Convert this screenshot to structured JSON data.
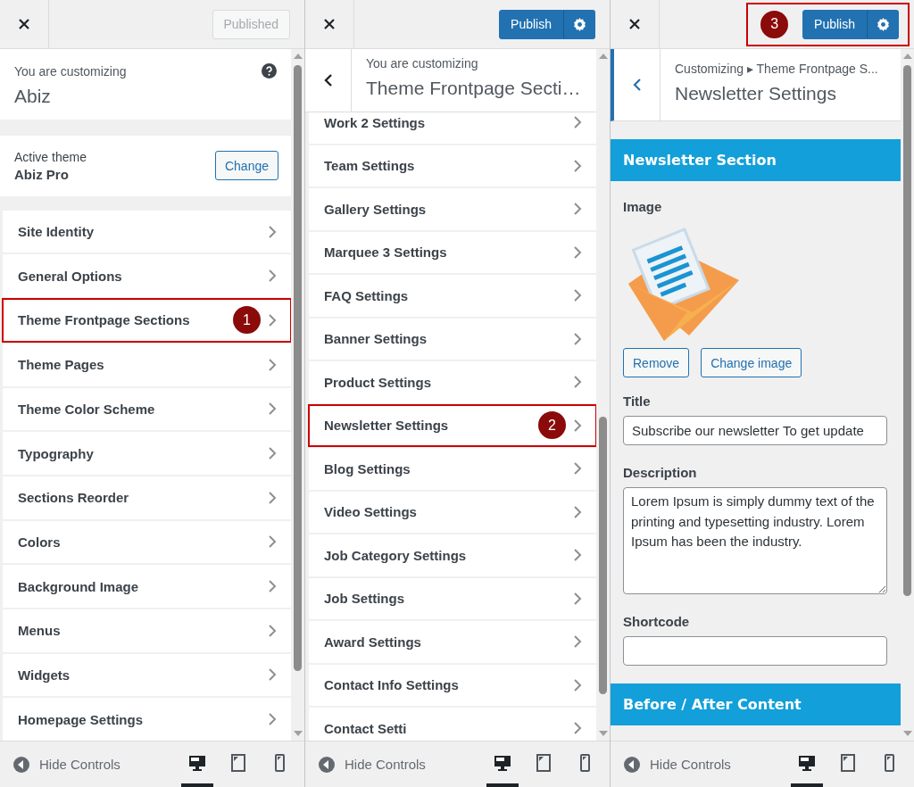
{
  "panels": [
    {
      "kind": "root",
      "publish": {
        "label": "Published",
        "disabled": true,
        "gear": false
      },
      "customizing": {
        "label": "You are customizing",
        "title": "Abiz"
      },
      "active_theme": {
        "label": "Active theme",
        "name": "Abiz Pro",
        "button": "Change"
      },
      "items": [
        {
          "label": "Site Identity",
          "highlighted": false
        },
        {
          "label": "General Options",
          "highlighted": false
        },
        {
          "label": "Theme Frontpage Sections",
          "highlighted": true,
          "callout": "1"
        },
        {
          "label": "Theme Pages",
          "highlighted": false
        },
        {
          "label": "Theme Color Scheme",
          "highlighted": false
        },
        {
          "label": "Typography",
          "highlighted": false
        },
        {
          "label": "Sections Reorder",
          "highlighted": false
        },
        {
          "label": "Colors",
          "highlighted": false
        },
        {
          "label": "Background Image",
          "highlighted": false
        },
        {
          "label": "Menus",
          "highlighted": false
        },
        {
          "label": "Widgets",
          "highlighted": false
        },
        {
          "label": "Homepage Settings",
          "highlighted": false
        }
      ],
      "footer": {
        "hide_label": "Hide Controls",
        "devices": [
          {
            "kind": "desktop",
            "selected": true
          },
          {
            "kind": "tablet",
            "selected": false
          },
          {
            "kind": "mobile",
            "selected": false
          }
        ]
      }
    },
    {
      "kind": "section",
      "publish": {
        "label": "Publish",
        "disabled": false,
        "gear": true
      },
      "customizing": {
        "label": "You are customizing",
        "title": "Theme Frontpage Secti…"
      },
      "items": [
        {
          "label": "Work 2 Settings",
          "highlighted": false
        },
        {
          "label": "Team Settings",
          "highlighted": false
        },
        {
          "label": "Gallery Settings",
          "highlighted": false
        },
        {
          "label": "Marquee 3 Settings",
          "highlighted": false
        },
        {
          "label": "FAQ Settings",
          "highlighted": false
        },
        {
          "label": "Banner Settings",
          "highlighted": false
        },
        {
          "label": "Product Settings",
          "highlighted": false
        },
        {
          "label": "Newsletter Settings",
          "highlighted": true,
          "callout": "2"
        },
        {
          "label": "Blog Settings",
          "highlighted": false
        },
        {
          "label": "Video Settings",
          "highlighted": false
        },
        {
          "label": "Job Category Settings",
          "highlighted": false
        },
        {
          "label": "Job Settings",
          "highlighted": false
        },
        {
          "label": "Award Settings",
          "highlighted": false
        },
        {
          "label": "Contact Info Settings",
          "highlighted": false
        },
        {
          "label": "Contact Setti",
          "highlighted": false
        }
      ],
      "footer": {
        "hide_label": "Hide Controls",
        "devices": [
          {
            "kind": "desktop",
            "selected": true
          },
          {
            "kind": "tablet",
            "selected": false
          },
          {
            "kind": "mobile",
            "selected": false
          }
        ]
      }
    },
    {
      "kind": "control",
      "publish": {
        "label": "Publish",
        "disabled": false,
        "gear": true
      },
      "callout": "3",
      "breadcrumb": {
        "root": "Customizing",
        "separator": "▸",
        "parent": "Theme Frontpage S...",
        "title": "Newsletter Settings"
      },
      "section_title": "Newsletter Section",
      "fields": [
        {
          "kind": "image",
          "label": "Image",
          "buttons": [
            "Remove",
            "Change image"
          ]
        },
        {
          "kind": "text",
          "label": "Title",
          "value": "Subscribe our newsletter To get update"
        },
        {
          "kind": "textarea",
          "label": "Description",
          "value": "Lorem Ipsum is simply dummy text of the printing and typesetting industry. Lorem Ipsum has been the industry."
        },
        {
          "kind": "text",
          "label": "Shortcode"
        }
      ],
      "next_section": "Before / After Content",
      "footer": {
        "hide_label": "Hide Controls",
        "devices": [
          {
            "kind": "desktop",
            "selected": true
          },
          {
            "kind": "tablet",
            "selected": false
          },
          {
            "kind": "mobile",
            "selected": false
          }
        ]
      }
    }
  ]
}
